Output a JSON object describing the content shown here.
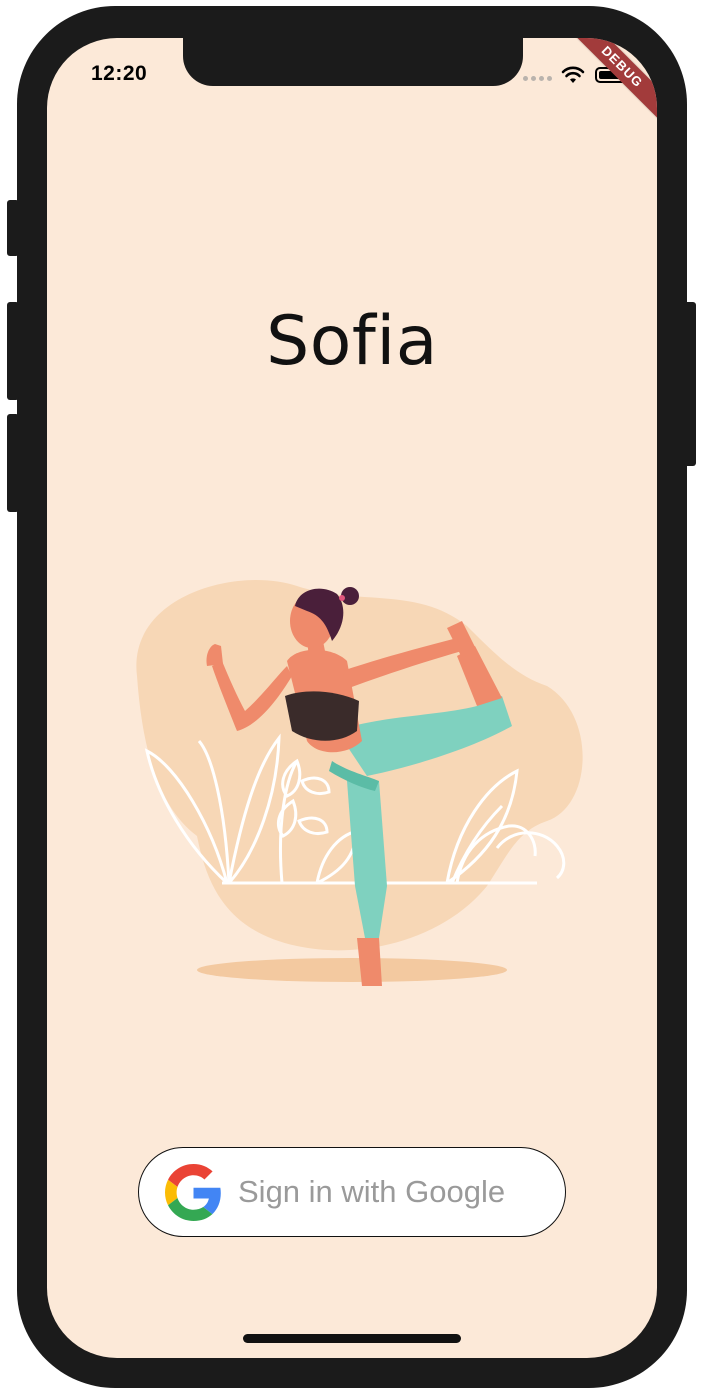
{
  "status_bar": {
    "time": "12:20",
    "debug_banner": "DEBUG"
  },
  "app": {
    "title": "Sofia"
  },
  "illustration": {
    "icon": "yoga-pose-illustration"
  },
  "sign_in": {
    "label": "Sign in with Google",
    "icon": "google-g-icon"
  },
  "colors": {
    "background": "#fce9d8",
    "blob": "#f7d7b6",
    "leggings": "#7fd1bf",
    "skin": "#ef8a6b",
    "top": "#3a2b2a",
    "hair": "#4a1f3a",
    "debug_ribbon": "#a23b3b"
  }
}
